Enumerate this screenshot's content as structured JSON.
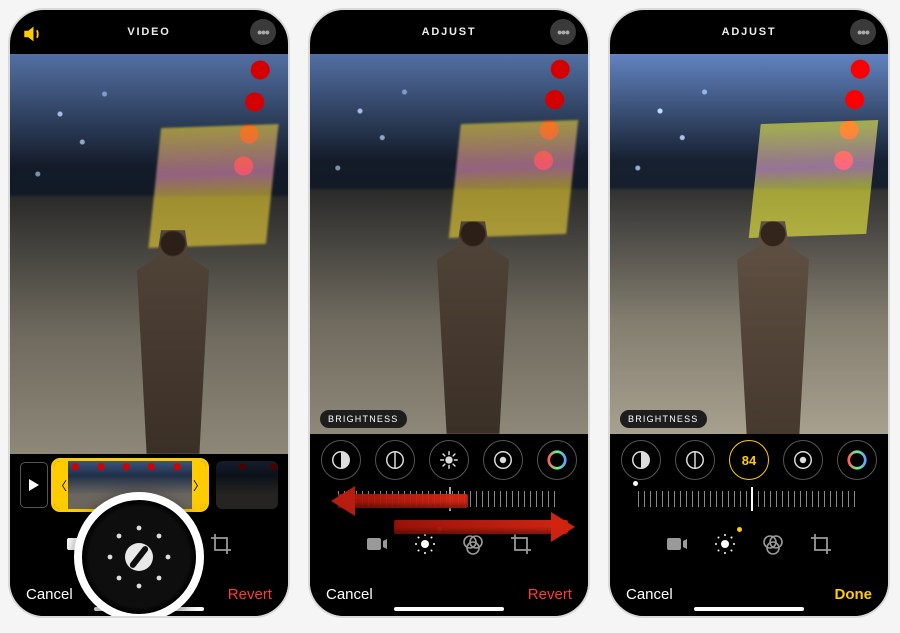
{
  "screens": [
    {
      "title": "VIDEO",
      "left_icon": "speaker-on-icon",
      "cancel": "Cancel",
      "action": "Revert",
      "action_kind": "revert",
      "highlight": "adjust-tab"
    },
    {
      "title": "ADJUST",
      "badge": "BRIGHTNESS",
      "adjust_value": null,
      "cancel": "Cancel",
      "action": "Revert",
      "action_kind": "revert"
    },
    {
      "title": "ADJUST",
      "badge": "BRIGHTNESS",
      "adjust_value": "84",
      "cancel": "Cancel",
      "action": "Done",
      "action_kind": "done"
    }
  ],
  "adjust_icons": [
    "exposure-icon",
    "highlights-icon",
    "brightness-icon",
    "contrast-icon",
    "saturation-icon"
  ],
  "tool_tabs": [
    "video-tab",
    "adjust-tab",
    "filters-tab",
    "crop-tab"
  ],
  "colors": {
    "accent": "#ffcc00",
    "destructive": "#ff3b30"
  }
}
